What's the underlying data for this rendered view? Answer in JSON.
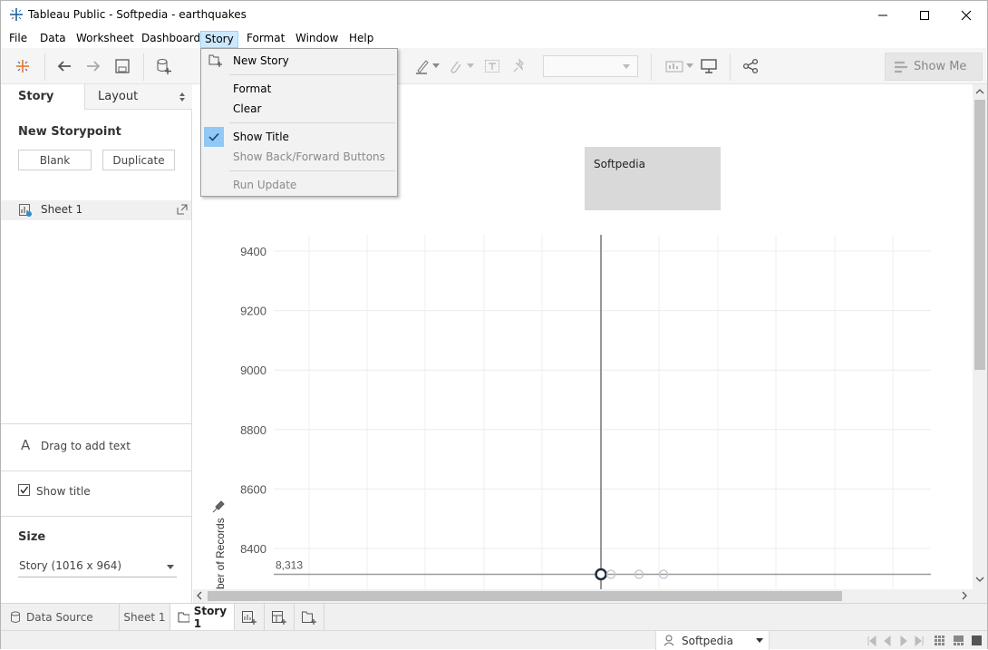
{
  "window": {
    "title": "Tableau Public - Softpedia - earthquakes",
    "icon": "tableau-logo-icon"
  },
  "menubar": {
    "items": [
      {
        "label": "File"
      },
      {
        "label": "Data"
      },
      {
        "label": "Worksheet"
      },
      {
        "label": "Dashboard"
      },
      {
        "label": "Story"
      },
      {
        "label": "Format"
      },
      {
        "label": "Window"
      },
      {
        "label": "Help"
      }
    ],
    "open_menu": "Story"
  },
  "story_menu": {
    "items": [
      {
        "label": "New Story",
        "icon": "new-story-icon",
        "enabled": true
      },
      {
        "label": "Format",
        "enabled": true
      },
      {
        "label": "Clear",
        "enabled": true
      },
      {
        "label": "Show Title",
        "enabled": true,
        "checked": true
      },
      {
        "label": "Show Back/Forward Buttons",
        "enabled": false
      },
      {
        "label": "Run Update",
        "enabled": false
      }
    ]
  },
  "toolbar": {
    "show_me_label": "Show Me"
  },
  "left_panel": {
    "tab_story": "Story",
    "tab_layout": "Layout",
    "new_storypoint_title": "New Storypoint",
    "blank_button": "Blank",
    "duplicate_button": "Duplicate",
    "sheet_item": "Sheet 1",
    "drag_text_label": "Drag to add text",
    "drag_text_icon_glyph": "A",
    "show_title_label": "Show title",
    "show_title_checked": true,
    "size_title": "Size",
    "size_value": "Story (1016 x 964)"
  },
  "canvas": {
    "story_title": "Softpedia"
  },
  "chart_data": {
    "type": "scatter",
    "ylabel": "ber of Records",
    "yticks": [
      9400,
      9200,
      9000,
      8800,
      8600,
      8400
    ],
    "ylim": [
      8290,
      9460
    ],
    "reference_line_value": 8313,
    "reference_line_label": "8,313",
    "points": [
      {
        "y": 8313,
        "highlighted": true
      },
      {
        "y": 8313,
        "highlighted": false
      },
      {
        "y": 8313,
        "highlighted": false
      },
      {
        "y": 8313,
        "highlighted": false
      }
    ],
    "grid": true
  },
  "bottom_tabs": {
    "data_source": "Data Source",
    "sheet": "Sheet 1",
    "story": "Story 1"
  },
  "statusbar": {
    "user": "Softpedia"
  },
  "colors": {
    "menu_highlight": "#cce8ff",
    "check_highlight": "#90c8f6",
    "title_box": "#d9d9d9"
  }
}
